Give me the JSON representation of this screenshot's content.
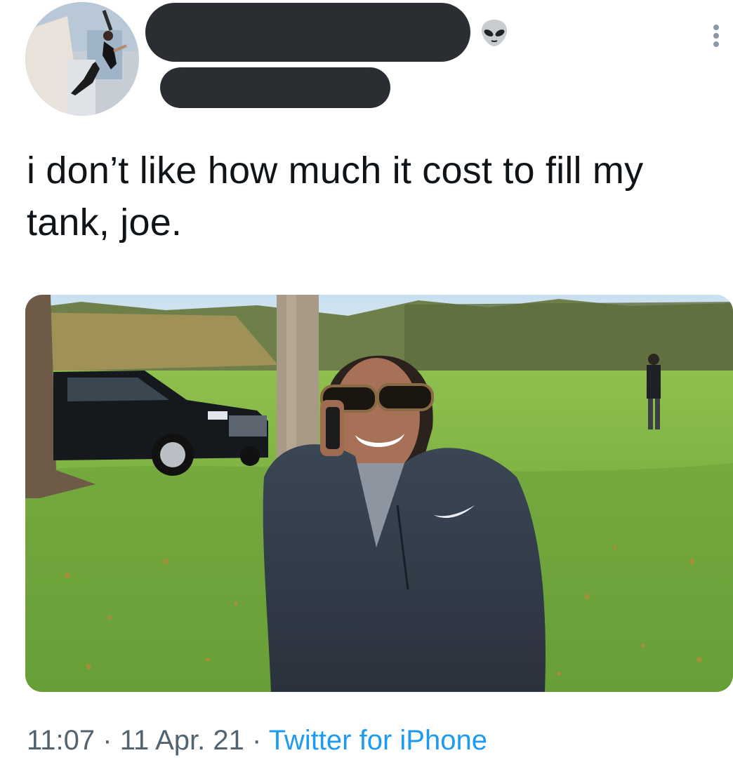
{
  "tweet": {
    "text": "i don’t like how much it cost to fill my tank, joe.",
    "time": "11:07",
    "separator": " · ",
    "date": "11 Apr. 21",
    "source": "Twitter for iPhone"
  },
  "header": {
    "display_name": "",
    "handle": "",
    "name_emoji": "alien-emoji-icon",
    "menu_icon": "more-vertical-icon"
  },
  "media": {
    "description_icon": "photo",
    "nike_brand_icon": "nike-swoosh-icon"
  },
  "colors": {
    "text": "#0f1419",
    "meta": "#536471",
    "link": "#1d9bf0",
    "redaction": "#2a2d31"
  }
}
